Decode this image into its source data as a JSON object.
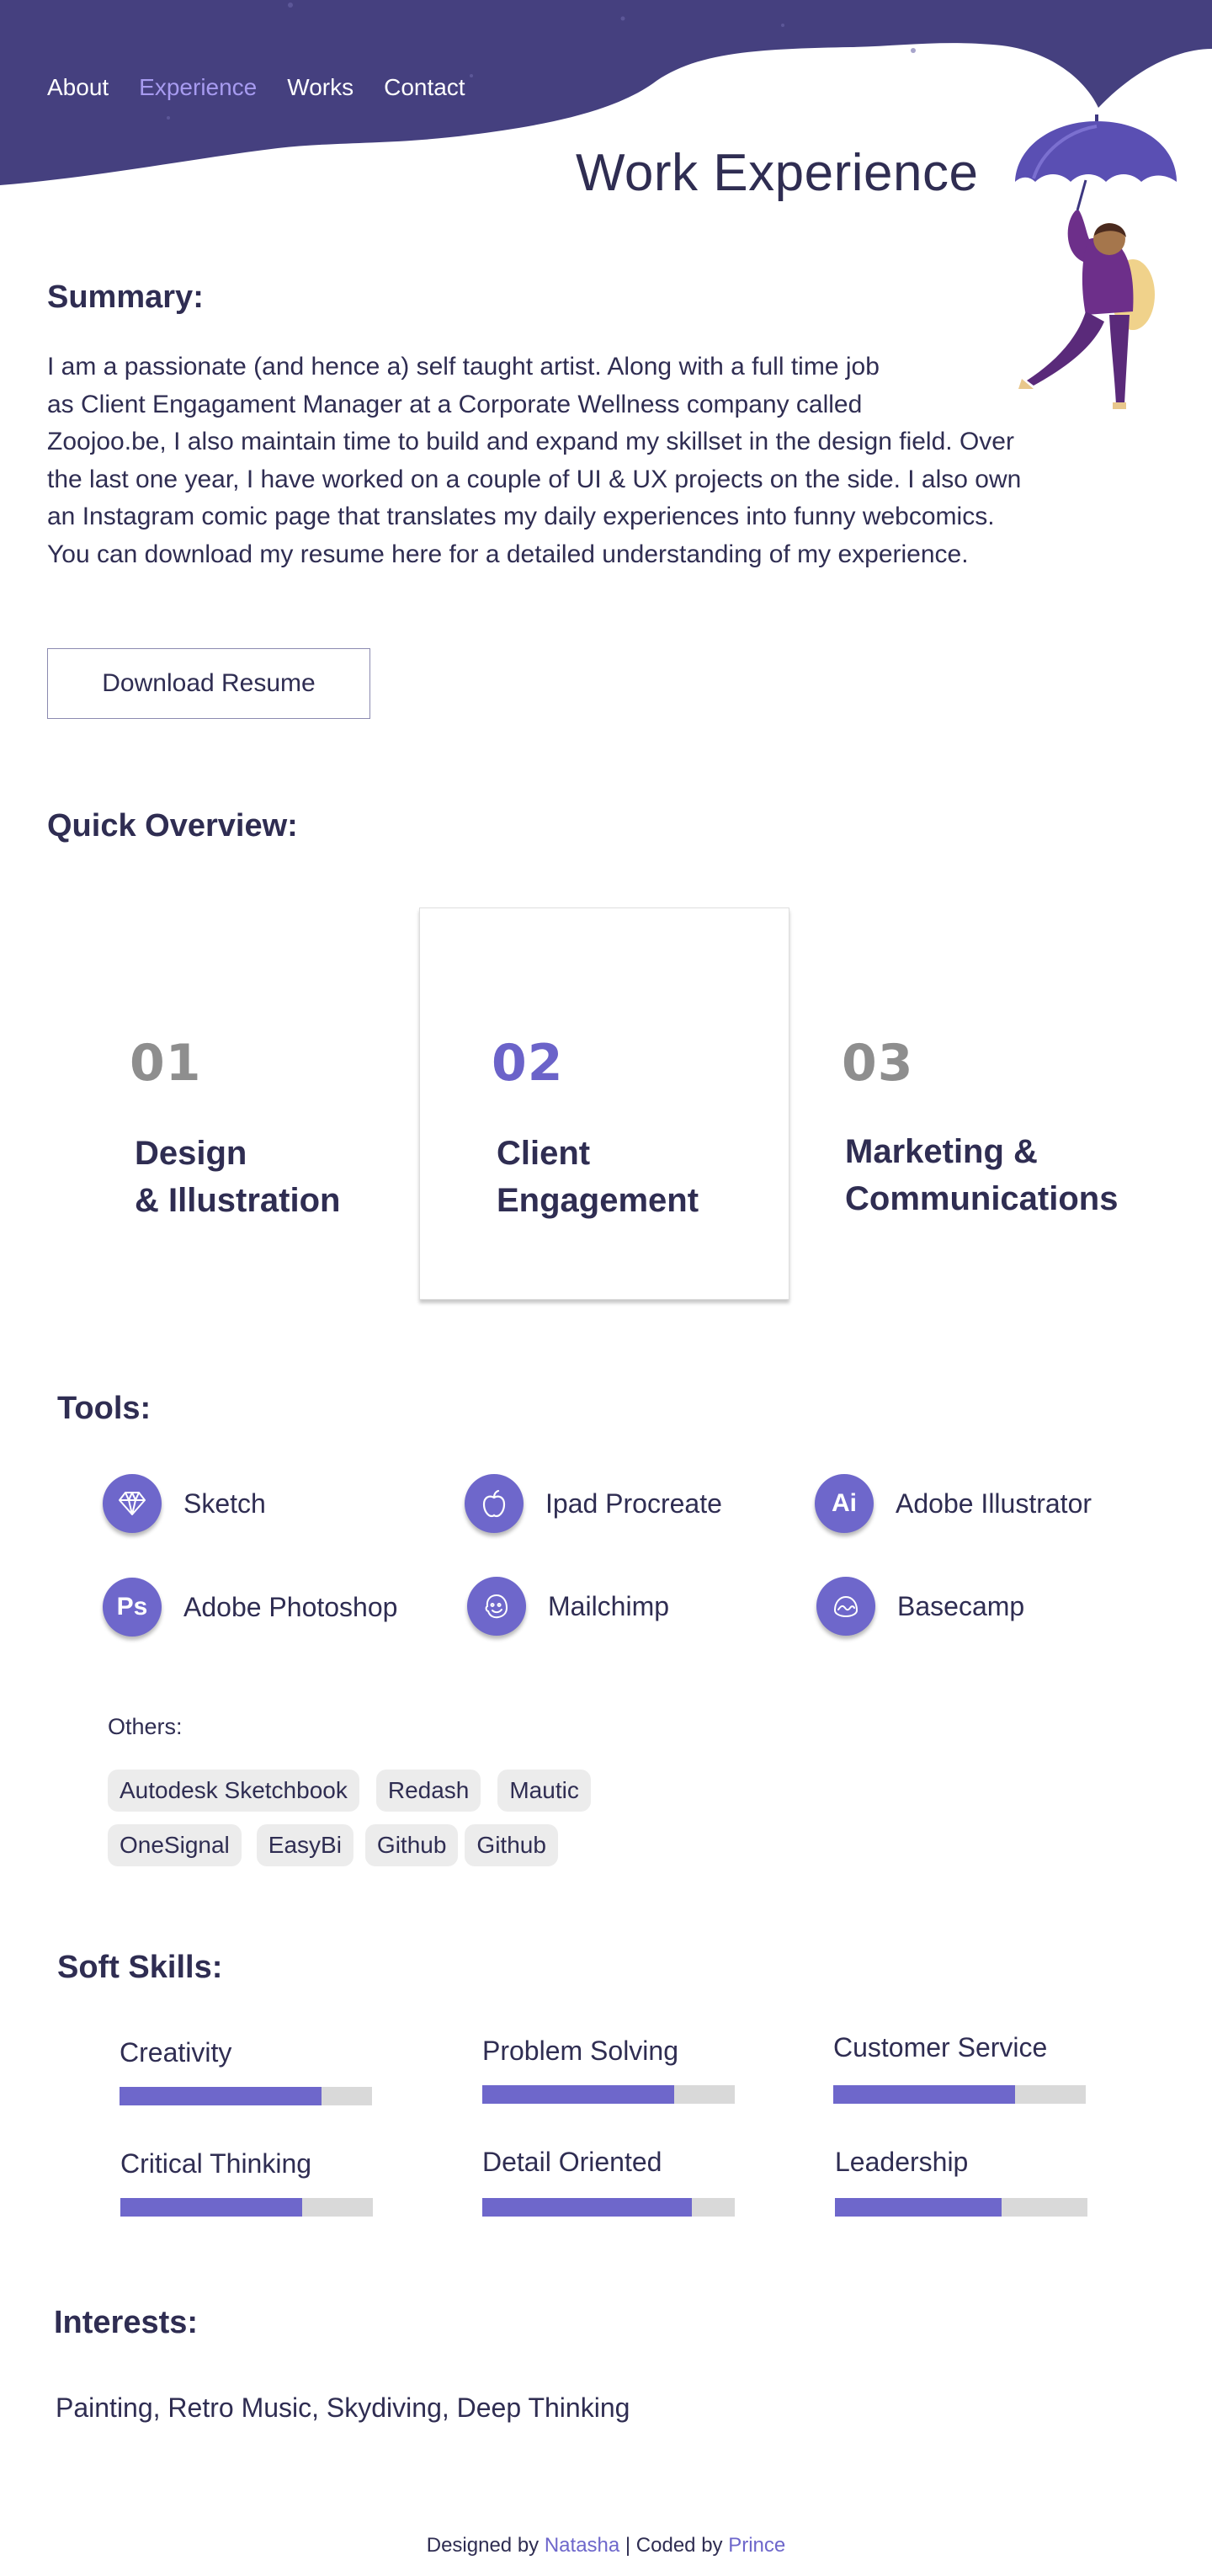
{
  "nav": {
    "items": [
      {
        "label": "About",
        "active": false
      },
      {
        "label": "Experience",
        "active": true
      },
      {
        "label": "Works",
        "active": false
      },
      {
        "label": "Contact",
        "active": false
      }
    ]
  },
  "page_title": "Work Experience",
  "summary": {
    "heading": "Summary:",
    "lines": [
      "I am a passionate (and hence a) self taught artist. Along with a full time job",
      "as Client Engagament Manager at a Corporate Wellness company called",
      "Zoojoo.be, I also maintain time to build and expand my skillset in the design field. Over",
      "the last one year, I have worked on a couple of UI & UX projects on the side. I also own",
      "an Instagram comic page that translates my daily experiences into funny webcomics.",
      "You can download my resume here for a detailed understanding of my experience."
    ],
    "download_label": "Download Resume"
  },
  "overview": {
    "heading": "Quick Overview:",
    "cards": [
      {
        "number": "01",
        "title_line1": "Design",
        "title_line2": "& Illustration"
      },
      {
        "number": "02",
        "title_line1": "Client",
        "title_line2": "Engagement",
        "active": true
      },
      {
        "number": "03",
        "title_line1": "Marketing &",
        "title_line2": "Communications"
      }
    ]
  },
  "tools": {
    "heading": "Tools:",
    "items": [
      {
        "label": "Sketch",
        "icon": "sketch-diamond-icon"
      },
      {
        "label": "Ipad Procreate",
        "icon": "apple-icon"
      },
      {
        "label": "Adobe Illustrator",
        "icon": "illustrator-icon",
        "glyph": "Ai"
      },
      {
        "label": "Adobe Photoshop",
        "icon": "photoshop-icon",
        "glyph": "Ps"
      },
      {
        "label": "Mailchimp",
        "icon": "mailchimp-icon"
      },
      {
        "label": "Basecamp",
        "icon": "basecamp-icon"
      }
    ],
    "others_label": "Others:",
    "others": [
      "Autodesk Sketchbook",
      "Redash",
      "Mautic",
      "OneSignal",
      "EasyBi",
      "Github",
      "Github"
    ]
  },
  "soft_skills": {
    "heading": "Soft Skills:",
    "items": [
      {
        "label": "Creativity",
        "level": 0.8
      },
      {
        "label": "Problem Solving",
        "level": 0.76
      },
      {
        "label": "Customer Service",
        "level": 0.72
      },
      {
        "label": "Critical Thinking",
        "level": 0.72
      },
      {
        "label": "Detail Oriented",
        "level": 0.83
      },
      {
        "label": "Leadership",
        "level": 0.66
      }
    ]
  },
  "interests": {
    "heading": "Interests:",
    "text": "Painting, Retro Music, Skydiving, Deep Thinking"
  },
  "footer": {
    "designed_by": "Designed by",
    "designer": "Natasha",
    "separator": "| Coded by",
    "coder": "Prince"
  },
  "colors": {
    "header_bg": "#45407f",
    "accent": "#6e67cb",
    "nav_active": "#a79bf0",
    "text": "#2f2d52",
    "muted_number": "#8e8e8e"
  }
}
